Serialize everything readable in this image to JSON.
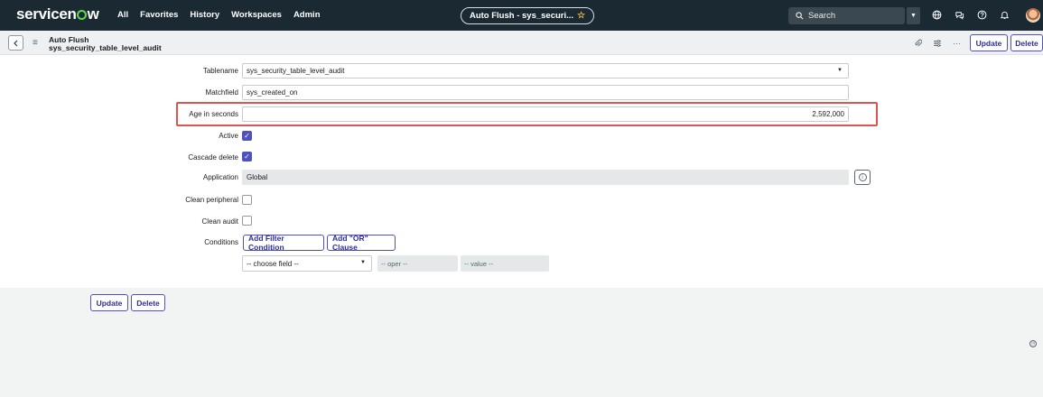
{
  "nav": {
    "logo_pre": "servicen",
    "logo_post": "w",
    "menu": [
      "All",
      "Favorites",
      "History",
      "Workspaces",
      "Admin"
    ],
    "tab_title": "Auto Flush - sys_securi...",
    "search_placeholder": "Search",
    "icons": [
      "globe-icon",
      "chat-icon",
      "help-icon",
      "bell-icon"
    ]
  },
  "header": {
    "title_line1": "Auto Flush",
    "title_line2": "sys_security_table_level_audit",
    "update_label": "Update",
    "delete_label": "Delete"
  },
  "form": {
    "tablename": {
      "label": "Tablename",
      "value": "sys_security_table_level_audit"
    },
    "matchfield": {
      "label": "Matchfield",
      "value": "sys_created_on"
    },
    "age": {
      "label": "Age in seconds",
      "value": "2,592,000"
    },
    "active": {
      "label": "Active",
      "checked": true
    },
    "cascade": {
      "label": "Cascade delete",
      "checked": true
    },
    "application": {
      "label": "Application",
      "value": "Global"
    },
    "clean_peripheral": {
      "label": "Clean peripheral",
      "checked": false
    },
    "clean_audit": {
      "label": "Clean audit",
      "checked": false
    },
    "conditions": {
      "label": "Conditions",
      "add_filter": "Add Filter Condition",
      "add_or": "Add \"OR\" Clause",
      "choose_field": "-- choose field --",
      "oper": "-- oper --",
      "value": "-- value --"
    }
  },
  "footer": {
    "update_label": "Update",
    "delete_label": "Delete"
  },
  "colors": {
    "nav_bg": "#1b2a32",
    "accent": "#4f52bd",
    "highlight": "#e0534f",
    "brand_green": "#62d84e"
  }
}
